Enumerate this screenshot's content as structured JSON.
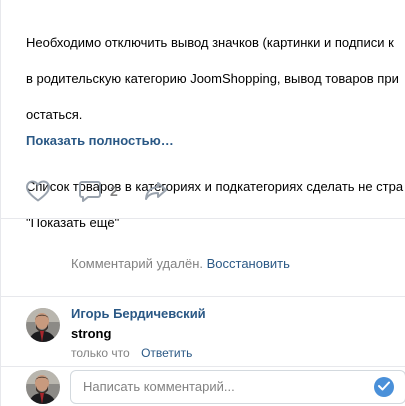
{
  "post": {
    "lines": [
      "Необходимо отключить вывод значков (картинки и подписи к",
      "в родительскую категорию JoomShopping, вывод товаров при",
      "остаться.",
      "",
      "Список товаров в категориях и подкатегориях сделать не стра",
      "\"Показать ещё\""
    ],
    "show_more": "Показать полностью…"
  },
  "actions": {
    "like_icon": "heart-icon",
    "comment_icon": "comment-bubble-icon",
    "comment_count": "2",
    "share_icon": "share-arrow-icon"
  },
  "deleted_comment": {
    "text": "Комментарий удалён.",
    "restore": "Восстановить"
  },
  "comment": {
    "author": "Игорь Бердичевский",
    "text": "strong",
    "time": "только что",
    "reply": "Ответить"
  },
  "composer": {
    "placeholder": "Написать комментарий...",
    "send_icon": "check-send-icon"
  },
  "colors": {
    "link": "#2a5885",
    "muted": "#828282",
    "icon": "#99a2ad",
    "send": "#4a90d9"
  }
}
